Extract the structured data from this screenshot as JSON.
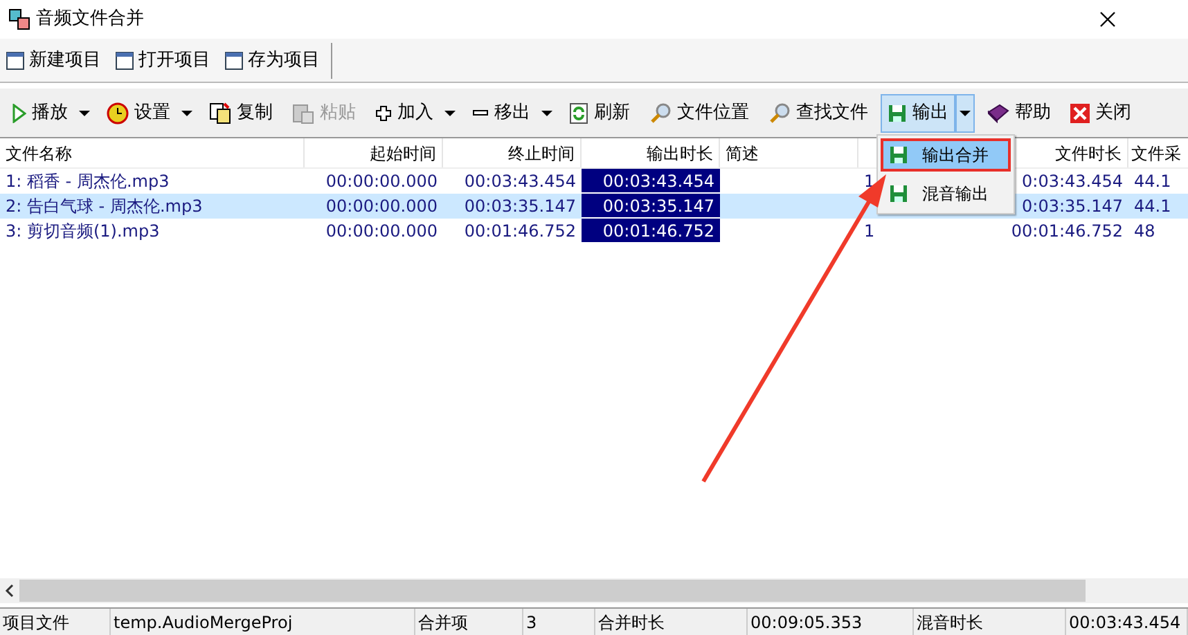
{
  "window": {
    "title": "音频文件合并"
  },
  "project_toolbar": [
    {
      "label": "新建项目"
    },
    {
      "label": "打开项目"
    },
    {
      "label": "存为项目"
    }
  ],
  "toolbar": [
    {
      "label": "播放",
      "dropdown": true,
      "disabled": false,
      "pressed": false
    },
    {
      "label": "设置",
      "dropdown": true,
      "disabled": false,
      "pressed": false
    },
    {
      "label": "复制",
      "dropdown": false,
      "disabled": false,
      "pressed": false
    },
    {
      "label": "粘贴",
      "dropdown": false,
      "disabled": true,
      "pressed": false
    },
    {
      "label": "加入",
      "dropdown": true,
      "disabled": false,
      "pressed": false
    },
    {
      "label": "移出",
      "dropdown": true,
      "disabled": false,
      "pressed": false
    },
    {
      "label": "刷新",
      "dropdown": false,
      "disabled": false,
      "pressed": false
    },
    {
      "label": "文件位置",
      "dropdown": false,
      "disabled": false,
      "pressed": false
    },
    {
      "label": "查找文件",
      "dropdown": false,
      "disabled": false,
      "pressed": false
    },
    {
      "label": "输出",
      "dropdown": true,
      "disabled": false,
      "pressed": true
    },
    {
      "label": "帮助",
      "dropdown": false,
      "disabled": false,
      "pressed": false
    },
    {
      "label": "关闭",
      "dropdown": false,
      "disabled": false,
      "pressed": false
    }
  ],
  "table": {
    "columns": [
      {
        "label": "文件名称"
      },
      {
        "label": "起始时间"
      },
      {
        "label": "终止时间"
      },
      {
        "label": "输出时长"
      },
      {
        "label": "简述"
      },
      {},
      {
        "label": "文件时长"
      },
      {
        "label": "文件采"
      }
    ],
    "rows": [
      {
        "selected": false,
        "cells": [
          "1: 稻香 - 周杰伦.mp3",
          "00:00:00.000",
          "00:03:43.454",
          "00:03:43.454",
          null,
          "1",
          "0:03:43.454",
          "44.1"
        ]
      },
      {
        "selected": true,
        "cells": [
          "2: 告白气球 - 周杰伦.mp3",
          "00:00:00.000",
          "00:03:35.147",
          "00:03:35.147",
          null,
          null,
          "0:03:35.147",
          "44.1"
        ]
      },
      {
        "selected": false,
        "cells": [
          "3: 剪切音频(1).mp3",
          "00:00:00.000",
          "00:01:46.752",
          "00:01:46.752",
          null,
          "1",
          "00:01:46.752",
          "48"
        ]
      }
    ]
  },
  "output_menu": [
    {
      "label": "输出合并",
      "selected": true,
      "outlined": true
    },
    {
      "label": "混音输出",
      "selected": false,
      "outlined": false
    }
  ],
  "status_bar": [
    "项目文件",
    "temp.AudioMergeProj",
    "合并项",
    "3",
    "合并时长",
    "00:09:05.353",
    "混音时长",
    "00:03:43.454"
  ]
}
